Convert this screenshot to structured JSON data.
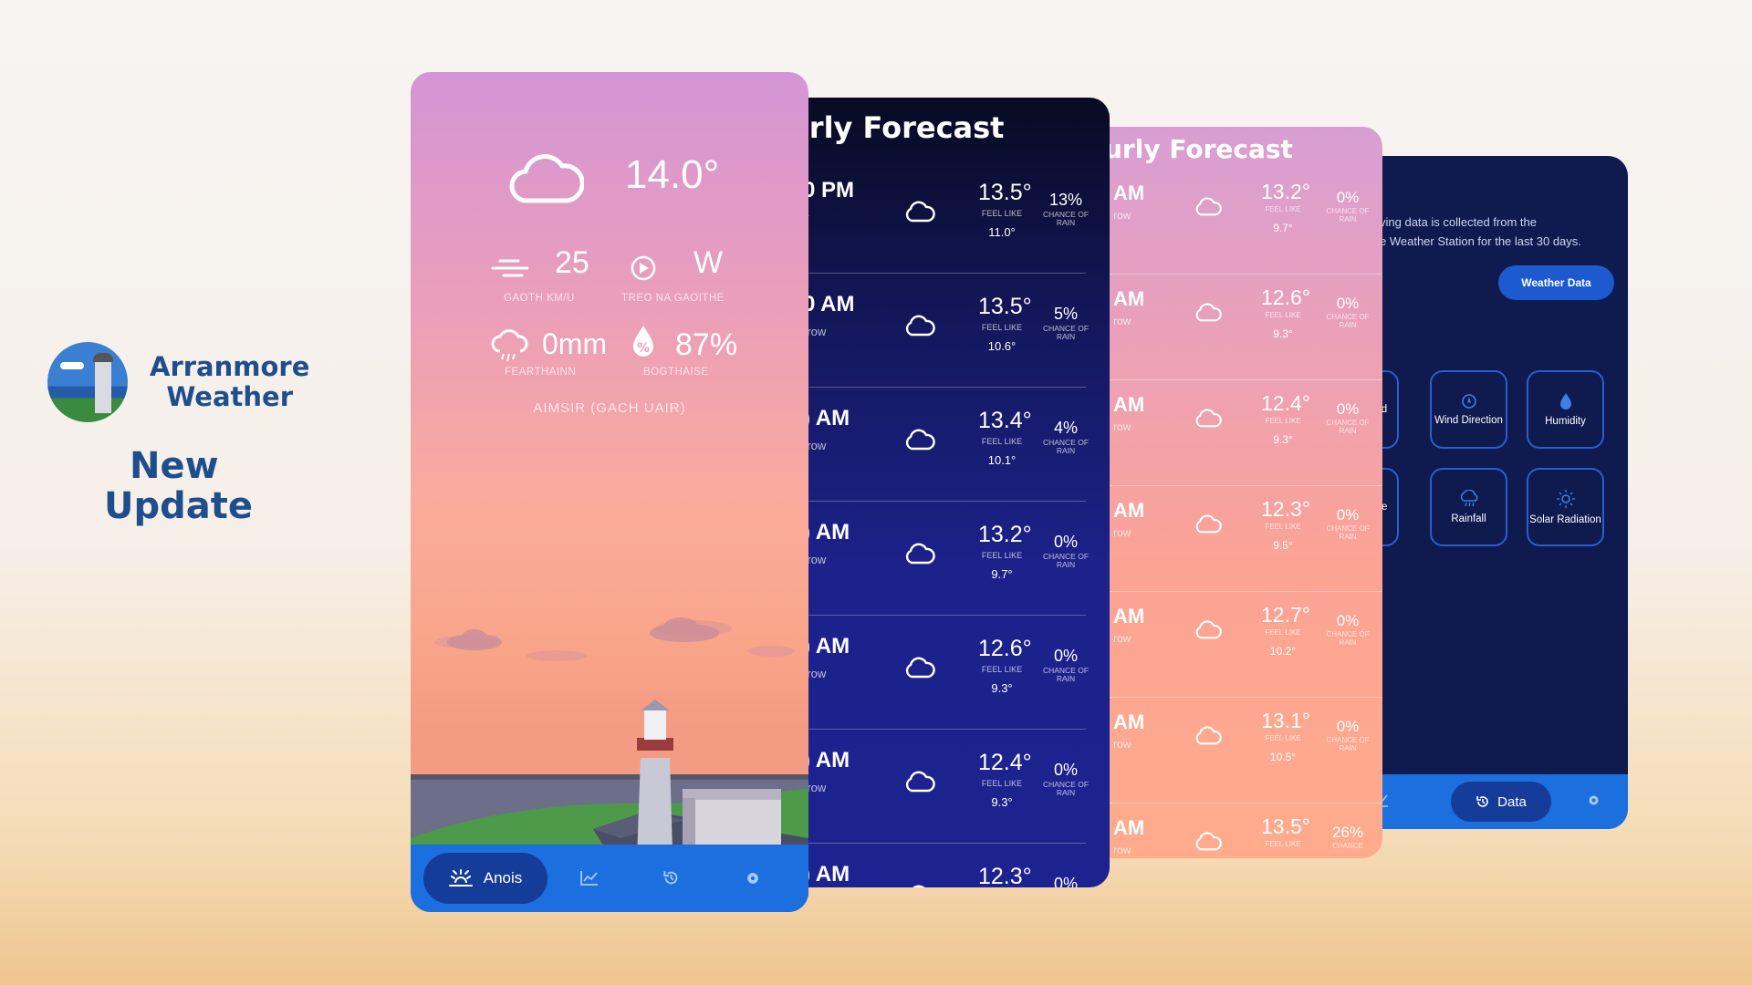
{
  "brand": {
    "name_line1": "Arranmore",
    "name_line2": "Weather",
    "tag_line1": "New",
    "tag_line2": "Update"
  },
  "main": {
    "temperature": "14.0°",
    "wind_speed": "25",
    "wind_speed_label": "GAOTH KM/U",
    "wind_direction": "W",
    "wind_direction_label": "TREO NA GAOITHE",
    "rainfall": "0mm",
    "rainfall_label": "FEARTHAINN",
    "humidity": "87%",
    "humidity_label": "BOGTHAISE",
    "period_label": "AIMSIR (GACH UAIR)",
    "nav": {
      "active_label": "Anois",
      "active_icon": "sun-icon",
      "icons": [
        "chart-icon",
        "history-icon",
        "gear-icon"
      ]
    },
    "colors": {
      "nav": "#1b6fdf",
      "pill": "#163c9a"
    }
  },
  "navy_forecast": {
    "title": "urly Forecast",
    "rows": [
      {
        "time": "0 PM",
        "day": "y",
        "temp": "13.5°",
        "feel_label": "FEEL LIKE",
        "feel": "11.0°",
        "chance": "13%",
        "chance_label": "CHANCE OF RAIN"
      },
      {
        "time": "0 AM",
        "day": "rrow",
        "temp": "13.5°",
        "feel_label": "FEEL LIKE",
        "feel": "10.6°",
        "chance": "5%",
        "chance_label": "CHANCE OF RAIN"
      },
      {
        "time": ") AM",
        "day": "rrow",
        "temp": "13.4°",
        "feel_label": "FEEL LIKE",
        "feel": "10.1°",
        "chance": "4%",
        "chance_label": "CHANCE OF RAIN"
      },
      {
        "time": ") AM",
        "day": "rrow",
        "temp": "13.2°",
        "feel_label": "FEEL LIKE",
        "feel": "9.7°",
        "chance": "0%",
        "chance_label": "CHANCE OF RAIN"
      },
      {
        "time": ") AM",
        "day": "rrow",
        "temp": "12.6°",
        "feel_label": "FEEL LIKE",
        "feel": "9.3°",
        "chance": "0%",
        "chance_label": "CHANCE OF RAIN"
      },
      {
        "time": ") AM",
        "day": "rrow",
        "temp": "12.4°",
        "feel_label": "FEEL LIKE",
        "feel": "9.3°",
        "chance": "0%",
        "chance_label": "CHANCE OF RAIN"
      },
      {
        "time": ") AM",
        "day": "",
        "temp": "12.3°",
        "feel_label": "",
        "feel": "",
        "chance": "0%",
        "chance_label": ""
      }
    ]
  },
  "pink_forecast": {
    "title": "urly Forecast",
    "rows": [
      {
        "time": "AM",
        "day": "row",
        "temp": "13.2°",
        "feel_label": "FEEL LIKE",
        "feel": "9.7°",
        "chance": "0%",
        "chance_label": "CHANCE OF RAIN"
      },
      {
        "time": "AM",
        "day": "row",
        "temp": "12.6°",
        "feel_label": "FEEL LIKE",
        "feel": "9.3°",
        "chance": "0%",
        "chance_label": "CHANCE OF RAIN"
      },
      {
        "time": "AM",
        "day": "row",
        "temp": "12.4°",
        "feel_label": "FEEL LIKE",
        "feel": "9.3°",
        "chance": "0%",
        "chance_label": "CHANCE OF RAIN"
      },
      {
        "time": "AM",
        "day": "row",
        "temp": "12.3°",
        "feel_label": "FEEL LIKE",
        "feel": "9.5°",
        "chance": "0%",
        "chance_label": "CHANCE OF RAIN"
      },
      {
        "time": "AM",
        "day": "row",
        "temp": "12.7°",
        "feel_label": "FEEL LIKE",
        "feel": "10.2°",
        "chance": "0%",
        "chance_label": "CHANCE OF RAIN"
      },
      {
        "time": "AM",
        "day": "row",
        "temp": "13.1°",
        "feel_label": "FEEL LIKE",
        "feel": "10.5°",
        "chance": "0%",
        "chance_label": "CHANCE OF RAIN"
      },
      {
        "time": "AM",
        "day": "row",
        "temp": "13.5°",
        "feel_label": "FEEL LIKE",
        "feel": "",
        "chance": "26%",
        "chance_label": "CHANCE"
      }
    ]
  },
  "data_screen": {
    "intro_line1": "ving data is collected from the",
    "intro_line2": "e Weather Station for the last 30 days.",
    "button_label": "Weather Data",
    "section_title": "s",
    "tiles": [
      {
        "label": "eed",
        "icon": "speed-icon"
      },
      {
        "label": "Wind Direction",
        "icon": "compass-icon"
      },
      {
        "label": "Humidity",
        "icon": "droplet-icon"
      },
      {
        "label": "ture",
        "icon": "thermometer-icon"
      },
      {
        "label": "Rainfall",
        "icon": "rain-cloud-icon"
      },
      {
        "label": "Solar Radiation",
        "icon": "sun-icon"
      }
    ],
    "nav": {
      "active_label": "Data",
      "active_icon": "history-icon",
      "icons": [
        "chart-icon",
        "gear-icon"
      ]
    }
  }
}
